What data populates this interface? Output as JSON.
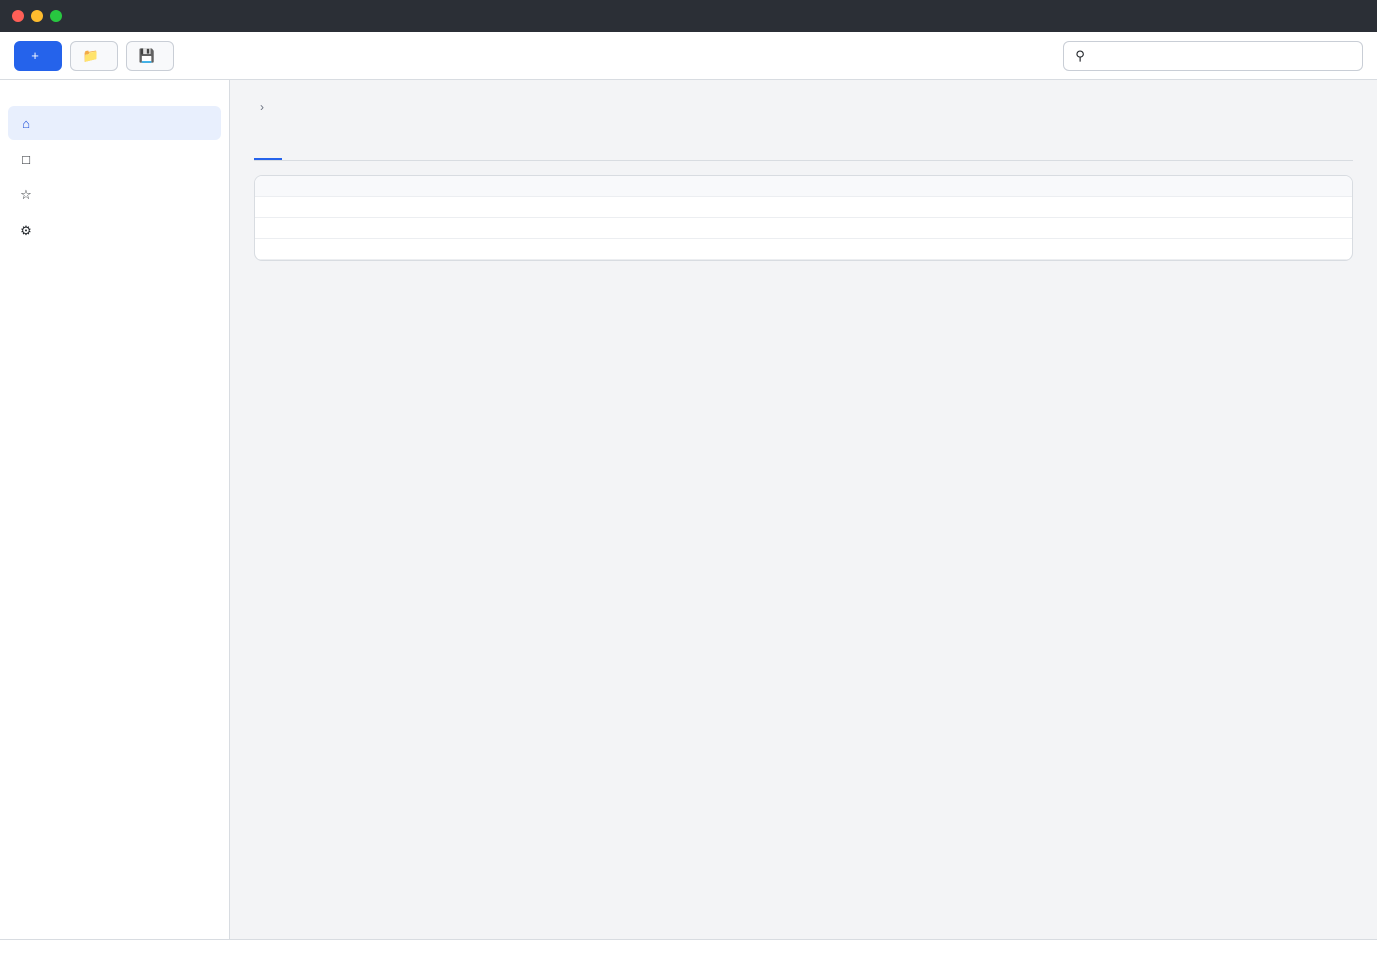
{
  "window": {
    "title": ""
  },
  "toolbar": {
    "new_label": "",
    "open_label": "",
    "save_label": ""
  },
  "search": {
    "placeholder": "",
    "value": ""
  },
  "sidebar": {
    "heading": "",
    "items": [
      {
        "label": "",
        "count": ""
      },
      {
        "label": "",
        "count": ""
      },
      {
        "label": "",
        "count": ""
      },
      {
        "label": "",
        "count": ""
      }
    ]
  },
  "breadcrumb": [
    "",
    ""
  ],
  "page": {
    "title": ""
  },
  "tabs": [
    {
      "label": ""
    },
    {
      "label": ""
    },
    {
      "label": ""
    }
  ],
  "table": {
    "columns": [
      "",
      "",
      "",
      ""
    ],
    "rows": [
      [
        "",
        "",
        "",
        ""
      ],
      [
        "",
        "",
        "",
        ""
      ],
      [
        "",
        "",
        "",
        ""
      ]
    ]
  },
  "status": {
    "left": "",
    "right": ""
  }
}
